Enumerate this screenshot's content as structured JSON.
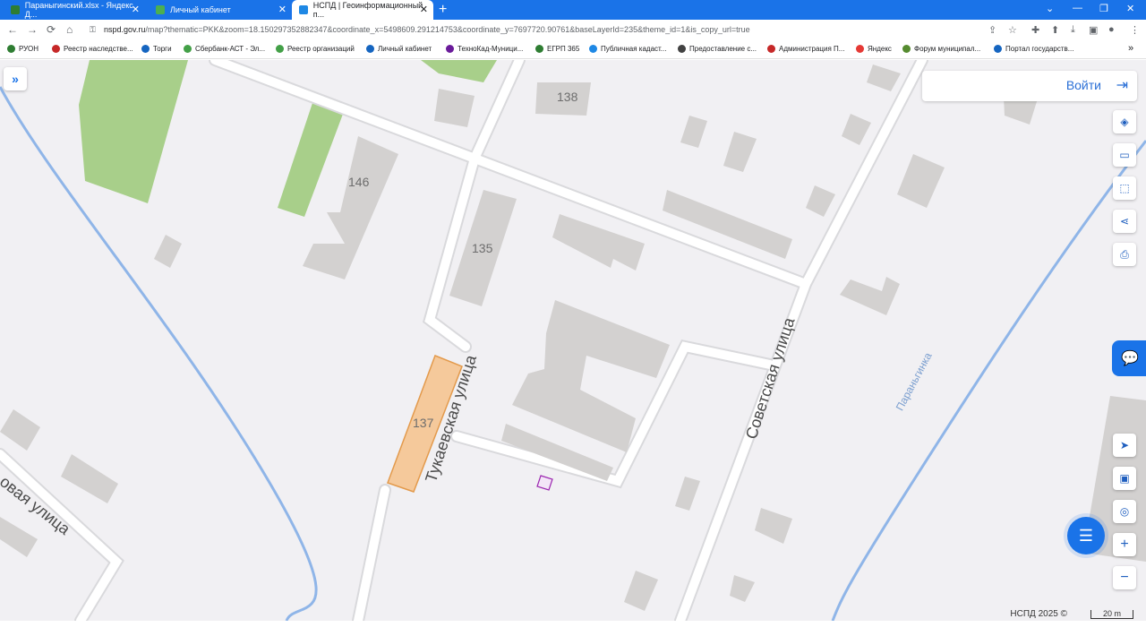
{
  "browser": {
    "tabs": [
      {
        "label": "Параныгинский.xlsx - Яндекс Д...",
        "close": "✕"
      },
      {
        "label": "Личный кабинет",
        "close": "✕"
      },
      {
        "label": "НСПД | Геоинформационный п...",
        "close": "✕"
      }
    ],
    "new_tab": "+",
    "window_controls": [
      "⌄",
      "—",
      "❐",
      "✕"
    ],
    "url_host": "nspd.gov.ru",
    "url_rest": "/map?thematic=PKK&zoom=18.150297352882347&coordinate_x=5498609.291214753&coordinate_y=7697720.90761&baseLayerId=235&theme_id=1&is_copy_url=true",
    "nav": {
      "back": "←",
      "forward": "→",
      "reload": "⟳",
      "home": "⌂"
    },
    "address_icons": [
      "⇪",
      "☆",
      "✚",
      "⬆",
      "⤓",
      "▣",
      "●",
      "⋮"
    ]
  },
  "bookmarks": [
    {
      "label": "РУОН",
      "color": "#2e7d32"
    },
    {
      "label": "Реестр наследстве...",
      "color": "#c62828"
    },
    {
      "label": "Торги",
      "color": "#1565c0"
    },
    {
      "label": "Сбербанк-АСТ - Эл...",
      "color": "#43a047"
    },
    {
      "label": "Реестр организаций",
      "color": "#43a047"
    },
    {
      "label": "Личный кабинет",
      "color": "#1565c0"
    },
    {
      "label": "ТехноКад-Муници...",
      "color": "#6a1b9a"
    },
    {
      "label": "ЕГРП 365",
      "color": "#2e7d32"
    },
    {
      "label": "Публичная кадаст...",
      "color": "#1e88e5"
    },
    {
      "label": "Предоставление с...",
      "color": "#424242"
    },
    {
      "label": "Администрация П...",
      "color": "#c62828"
    },
    {
      "label": "Яндекс",
      "color": "#e53935"
    },
    {
      "label": "Форум муниципал...",
      "color": "#558b2f"
    },
    {
      "label": "Портал государств...",
      "color": "#1565c0"
    }
  ],
  "bookmarks_more": "»",
  "map": {
    "side_toggle": "»",
    "login_label": "Войти",
    "login_icon": "⇥",
    "building_labels": [
      "138",
      "146",
      "135",
      "137"
    ],
    "streets": [
      "Тукаевская улица",
      "Советская улица",
      "овая улица"
    ],
    "river": "Параньгинка",
    "copyright": "НСПД 2025 ©",
    "scale": "20 m",
    "tools_top": [
      "◈",
      "▭",
      "⬚",
      "⋖",
      "⎙"
    ],
    "tools_bottom": [
      "➤",
      "▣",
      "◎",
      "+",
      "−"
    ],
    "chat_icon": "💬",
    "bubble_icon": "☰",
    "colors": {
      "background": "#f1f0f3",
      "road": "#ffffff",
      "road_edge": "#d9d9dc",
      "building": "#d3d1d0",
      "green": "#a8cf8a",
      "parcel": "#f5c99b",
      "parcel_edge": "#e39a4c",
      "river": "#8fb5e8",
      "accent": "#1a73e8"
    }
  }
}
